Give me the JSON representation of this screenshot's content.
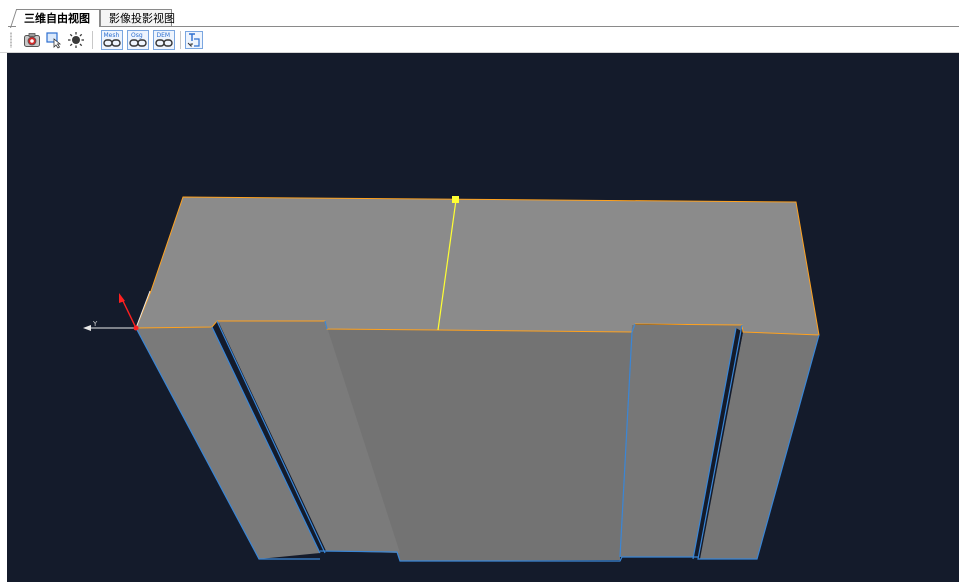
{
  "tabs": [
    {
      "label": "三维自由视图",
      "active": true
    },
    {
      "label": "影像投影视图",
      "active": false
    }
  ],
  "toolbar": {
    "buttons": [
      {
        "name": "camera-icon",
        "label": ""
      },
      {
        "name": "select-icon",
        "label": ""
      },
      {
        "name": "light-icon",
        "label": ""
      },
      {
        "name": "mesh-link-icon",
        "label": "Mesh"
      },
      {
        "name": "osg-link-icon",
        "label": "Osg"
      },
      {
        "name": "dem-link-icon",
        "label": "DEM"
      },
      {
        "name": "transform-icon",
        "label": ""
      }
    ]
  },
  "viewport": {
    "background": "#141b2b",
    "model_color": "#8a8a8a",
    "top_edge_color": "#ffa21f",
    "side_edge_color": "#3a86d6",
    "cut_line_color": "#ffff33",
    "axis_x_color": "#e8e8e8",
    "axis_y_color": "#ff2020",
    "axis_label": "Y"
  }
}
